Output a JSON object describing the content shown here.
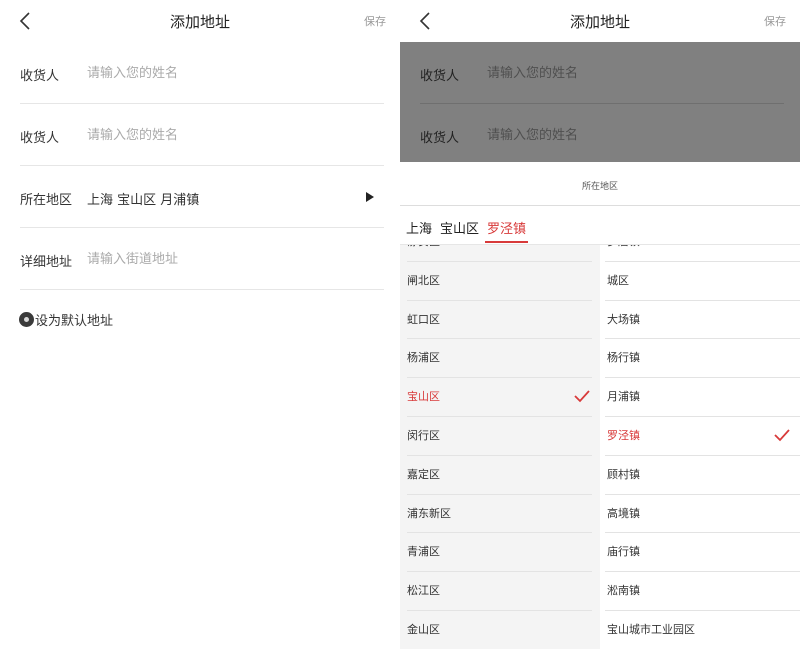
{
  "screen_left": {
    "header": {
      "title": "添加地址",
      "save_label": "保存"
    },
    "form": {
      "name1": {
        "label": "收货人",
        "placeholder": "请输入您的姓名"
      },
      "name2": {
        "label": "收货人",
        "placeholder": "请输入您的姓名"
      },
      "region": {
        "label": "所在地区",
        "value": "上海 宝山区 月浦镇"
      },
      "street": {
        "label": "详细地址",
        "placeholder": "请输入街道地址"
      },
      "default_label": "设为默认地址"
    }
  },
  "screen_right": {
    "header": {
      "title": "添加地址",
      "save_label": "保存"
    },
    "overlay_form": {
      "name1": {
        "label": "收货人",
        "placeholder": "请输入您的姓名"
      },
      "name2": {
        "label": "收货人",
        "placeholder": "请输入您的姓名"
      }
    },
    "picker": {
      "title": "所在地区",
      "tabs": [
        "上海",
        "宝山区",
        "罗泾镇"
      ],
      "active_tab": "罗泾镇",
      "districts": [
        "静安区",
        "闸北区",
        "虹口区",
        "杨浦区",
        "宝山区",
        "闵行区",
        "嘉定区",
        "浦东新区",
        "青浦区",
        "松江区",
        "金山区"
      ],
      "selected_district": "宝山区",
      "towns": [
        "罗店镇",
        "城区",
        "大场镇",
        "杨行镇",
        "月浦镇",
        "罗泾镇",
        "顾村镇",
        "高境镇",
        "庙行镇",
        "淞南镇",
        "宝山城市工业园区"
      ],
      "selected_town": "罗泾镇"
    }
  },
  "colors": {
    "accent": "#d83a3a",
    "overlay": "#808080",
    "left_column_bg": "#f4f4f4"
  },
  "icons": [
    "back-icon",
    "arrow-right-icon",
    "radio-icon",
    "check-icon"
  ]
}
